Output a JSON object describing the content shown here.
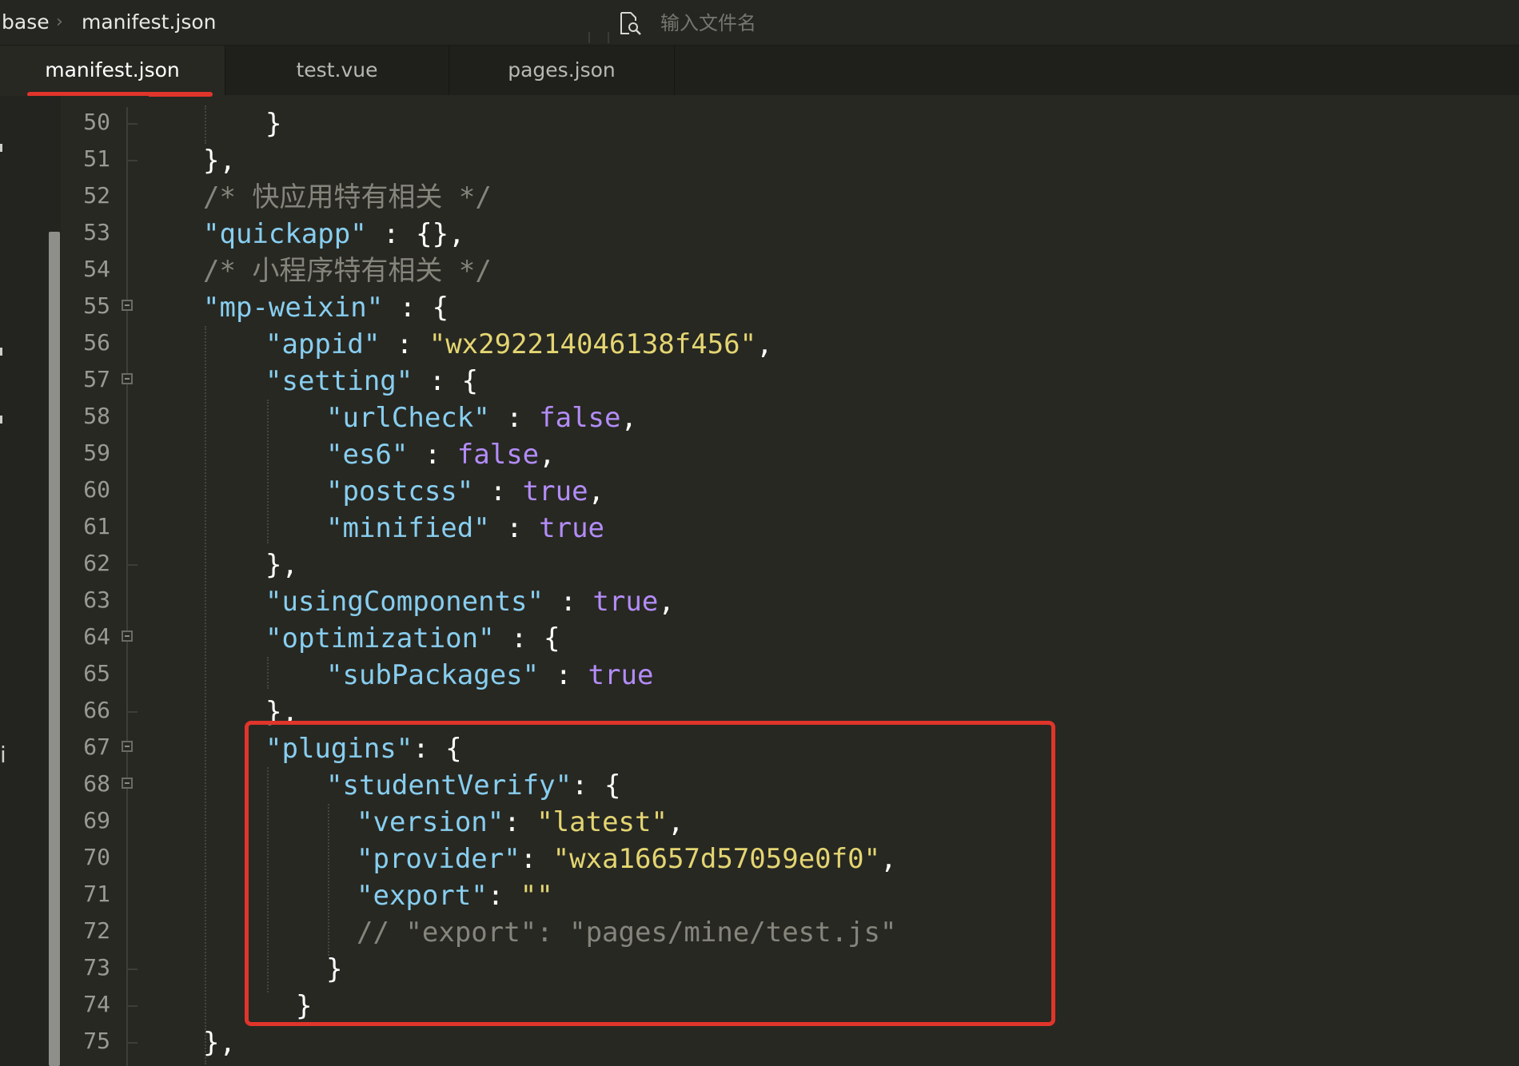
{
  "breadcrumb": {
    "parent": "base",
    "separator": "›",
    "file": "manifest.json"
  },
  "search": {
    "placeholder": "输入文件名",
    "icon": "file-search-icon"
  },
  "tabs": [
    {
      "label": "manifest.json",
      "active": true
    },
    {
      "label": "test.vue",
      "active": false
    },
    {
      "label": "pages.json",
      "active": false
    }
  ],
  "sidebar": {
    "glyph": "i"
  },
  "lines": [
    {
      "n": "50",
      "tokens": [
        {
          "t": "}",
          "c": "p"
        }
      ]
    },
    {
      "n": "51",
      "tokens": [
        {
          "t": "},",
          "c": "p"
        }
      ]
    },
    {
      "n": "52",
      "tokens": [
        {
          "t": "/* 快应用特有相关 */",
          "c": "c"
        }
      ]
    },
    {
      "n": "53",
      "tokens": [
        {
          "t": "\"quickapp\"",
          "c": "s"
        },
        {
          "t": " : {},",
          "c": "p"
        }
      ]
    },
    {
      "n": "54",
      "tokens": [
        {
          "t": "/* 小程序特有相关 */",
          "c": "c"
        }
      ]
    },
    {
      "n": "55",
      "tokens": [
        {
          "t": "\"mp-weixin\"",
          "c": "s"
        },
        {
          "t": " : {",
          "c": "p"
        }
      ]
    },
    {
      "n": "56",
      "tokens": [
        {
          "t": "\"appid\"",
          "c": "s"
        },
        {
          "t": " : ",
          "c": "p"
        },
        {
          "t": "\"wx292214046138f456\"",
          "c": "y"
        },
        {
          "t": ",",
          "c": "p"
        }
      ]
    },
    {
      "n": "57",
      "tokens": [
        {
          "t": "\"setting\"",
          "c": "s"
        },
        {
          "t": " : {",
          "c": "p"
        }
      ]
    },
    {
      "n": "58",
      "tokens": [
        {
          "t": "\"urlCheck\"",
          "c": "s"
        },
        {
          "t": " : ",
          "c": "p"
        },
        {
          "t": "false",
          "c": "b"
        },
        {
          "t": ",",
          "c": "p"
        }
      ]
    },
    {
      "n": "59",
      "tokens": [
        {
          "t": "\"es6\"",
          "c": "s"
        },
        {
          "t": " : ",
          "c": "p"
        },
        {
          "t": "false",
          "c": "b"
        },
        {
          "t": ",",
          "c": "p"
        }
      ]
    },
    {
      "n": "60",
      "tokens": [
        {
          "t": "\"postcss\"",
          "c": "s"
        },
        {
          "t": " : ",
          "c": "p"
        },
        {
          "t": "true",
          "c": "b"
        },
        {
          "t": ",",
          "c": "p"
        }
      ]
    },
    {
      "n": "61",
      "tokens": [
        {
          "t": "\"minified\"",
          "c": "s"
        },
        {
          "t": " : ",
          "c": "p"
        },
        {
          "t": "true",
          "c": "b"
        }
      ]
    },
    {
      "n": "62",
      "tokens": [
        {
          "t": "},",
          "c": "p"
        }
      ]
    },
    {
      "n": "63",
      "tokens": [
        {
          "t": "\"usingComponents\"",
          "c": "s"
        },
        {
          "t": " : ",
          "c": "p"
        },
        {
          "t": "true",
          "c": "b"
        },
        {
          "t": ",",
          "c": "p"
        }
      ]
    },
    {
      "n": "64",
      "tokens": [
        {
          "t": "\"optimization\"",
          "c": "s"
        },
        {
          "t": " : {",
          "c": "p"
        }
      ]
    },
    {
      "n": "65",
      "tokens": [
        {
          "t": "\"subPackages\"",
          "c": "s"
        },
        {
          "t": " : ",
          "c": "p"
        },
        {
          "t": "true",
          "c": "b"
        }
      ]
    },
    {
      "n": "66",
      "tokens": [
        {
          "t": "},",
          "c": "p"
        }
      ]
    },
    {
      "n": "67",
      "tokens": [
        {
          "t": "\"plugins\"",
          "c": "s"
        },
        {
          "t": ": {",
          "c": "p"
        }
      ]
    },
    {
      "n": "68",
      "tokens": [
        {
          "t": "\"studentVerify\"",
          "c": "s"
        },
        {
          "t": ": {",
          "c": "p"
        }
      ]
    },
    {
      "n": "69",
      "tokens": [
        {
          "t": "\"version\"",
          "c": "s"
        },
        {
          "t": ": ",
          "c": "p"
        },
        {
          "t": "\"latest\"",
          "c": "y"
        },
        {
          "t": ",",
          "c": "p"
        }
      ]
    },
    {
      "n": "70",
      "tokens": [
        {
          "t": "\"provider\"",
          "c": "s"
        },
        {
          "t": ": ",
          "c": "p"
        },
        {
          "t": "\"wxa16657d57059e0f0\"",
          "c": "y"
        },
        {
          "t": ",",
          "c": "p"
        }
      ]
    },
    {
      "n": "71",
      "tokens": [
        {
          "t": "\"export\"",
          "c": "s"
        },
        {
          "t": ": ",
          "c": "p"
        },
        {
          "t": "\"\"",
          "c": "y"
        }
      ]
    },
    {
      "n": "72",
      "tokens": [
        {
          "t": "// \"export\": \"pages/mine/test.js\"",
          "c": "c"
        }
      ]
    },
    {
      "n": "73",
      "tokens": [
        {
          "t": "}",
          "c": "p"
        }
      ]
    },
    {
      "n": "74",
      "tokens": [
        {
          "t": "}",
          "c": "p"
        }
      ]
    },
    {
      "n": "75",
      "tokens": [
        {
          "t": "},",
          "c": "p"
        }
      ]
    }
  ],
  "colors": {
    "background": "#272822",
    "string_key": "#88cef0",
    "string_value": "#e4d572",
    "boolean": "#b38cf7",
    "comment": "#85857c",
    "punctuation": "#ffffff",
    "highlight_box": "#e0352b"
  }
}
